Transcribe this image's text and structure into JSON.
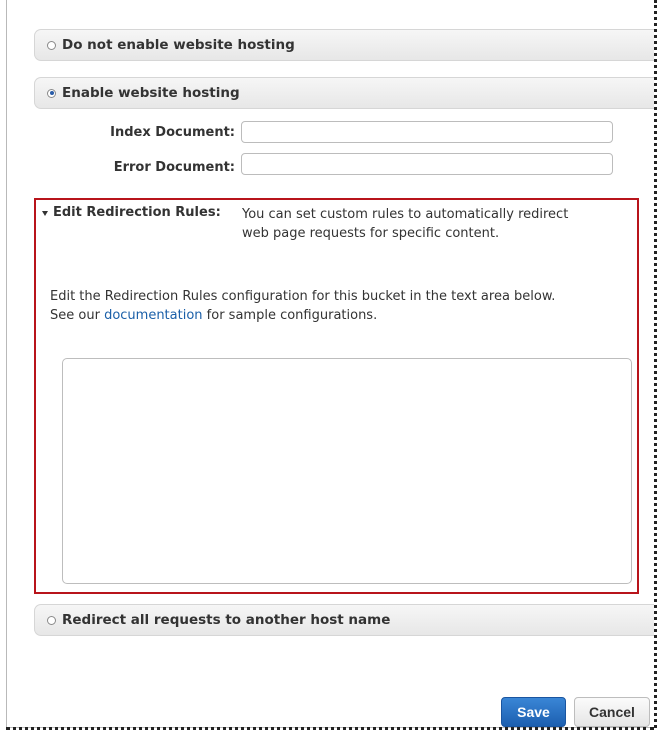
{
  "options": {
    "no_hosting_label": "Do not enable website hosting",
    "hosting_label": "Enable website hosting",
    "redirect_all_label": "Redirect all requests to another host name"
  },
  "hosting": {
    "index_label": "Index Document:",
    "index_value": "",
    "error_label": "Error Document:",
    "error_value": ""
  },
  "redirection": {
    "label": "Edit Redirection Rules:",
    "description": "You can set custom rules to automatically redirect web page requests for specific content.",
    "help_before": "Edit the Redirection Rules configuration for this bucket in the text area below. See our",
    "help_link": "documentation",
    "help_after": "for sample configurations.",
    "rules_value": ""
  },
  "buttons": {
    "save": "Save",
    "cancel": "Cancel"
  },
  "colors": {
    "highlight": "#b8141b",
    "save_button": "#1c5fb0",
    "link": "#1a5fa8"
  },
  "icons": [
    "radio-unselected",
    "radio-selected",
    "expand-triangle-icon"
  ]
}
